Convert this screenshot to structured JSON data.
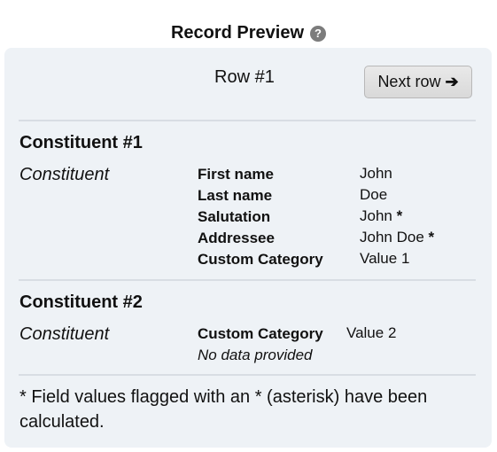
{
  "header": {
    "title": "Record Preview",
    "help_icon": "?"
  },
  "navigation": {
    "row_label": "Row #1",
    "next_label": "Next row",
    "next_icon": "arrow-right-icon"
  },
  "records": [
    {
      "heading": "Constituent #1",
      "type": "Constituent",
      "fields": [
        {
          "name": "First name",
          "value": "John",
          "flag": ""
        },
        {
          "name": "Last name",
          "value": "Doe",
          "flag": ""
        },
        {
          "name": "Salutation",
          "value": "John",
          "flag": "*"
        },
        {
          "name": "Addressee",
          "value": "John Doe",
          "flag": "*"
        },
        {
          "name": "Custom Category",
          "value": "Value 1",
          "flag": ""
        }
      ]
    },
    {
      "heading": "Constituent #2",
      "type": "Constituent",
      "fields": [
        {
          "name": "Custom Category",
          "value": "Value 2",
          "flag": ""
        }
      ],
      "note": "No data provided"
    }
  ],
  "footnote": "* Field values flagged with an * (asterisk) have been calculated."
}
